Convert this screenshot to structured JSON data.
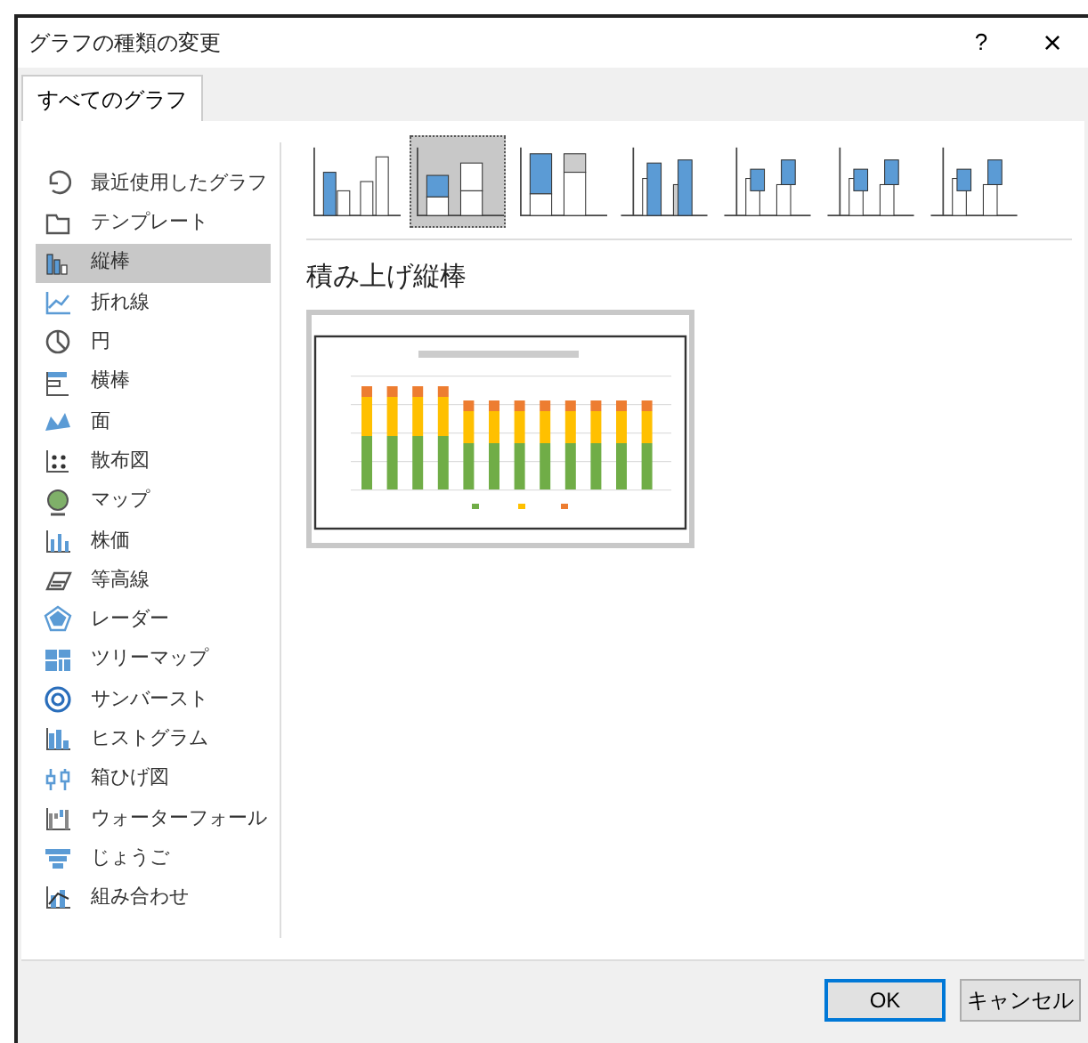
{
  "window": {
    "title": "グラフの種類の変更",
    "help": "?",
    "close": "×"
  },
  "tabs": [
    {
      "label": "すべてのグラフ",
      "selected": true
    }
  ],
  "sidebar": {
    "items": [
      {
        "label": "最近使用したグラフ",
        "selected": false
      },
      {
        "label": "テンプレート",
        "selected": false
      },
      {
        "label": "縦棒",
        "selected": true
      },
      {
        "label": "折れ線",
        "selected": false
      },
      {
        "label": "円",
        "selected": false
      },
      {
        "label": "横棒",
        "selected": false
      },
      {
        "label": "面",
        "selected": false
      },
      {
        "label": "散布図",
        "selected": false
      },
      {
        "label": "マップ",
        "selected": false
      },
      {
        "label": "株価",
        "selected": false
      },
      {
        "label": "等高線",
        "selected": false
      },
      {
        "label": "レーダー",
        "selected": false
      },
      {
        "label": "ツリーマップ",
        "selected": false
      },
      {
        "label": "サンバースト",
        "selected": false
      },
      {
        "label": "ヒストグラム",
        "selected": false
      },
      {
        "label": "箱ひげ図",
        "selected": false
      },
      {
        "label": "ウォーターフォール",
        "selected": false
      },
      {
        "label": "じょうご",
        "selected": false
      },
      {
        "label": "組み合わせ",
        "selected": false
      }
    ]
  },
  "subtypes": [
    {
      "selected": false
    },
    {
      "selected": true
    },
    {
      "selected": false
    },
    {
      "selected": false
    },
    {
      "selected": false
    },
    {
      "selected": false
    },
    {
      "selected": false
    }
  ],
  "preview": {
    "heading": "積み上げ縦棒",
    "kind": "picture"
  },
  "buttons": [
    {
      "label": "OK",
      "default": true
    },
    {
      "label": "キャンセル",
      "default": false
    }
  ]
}
